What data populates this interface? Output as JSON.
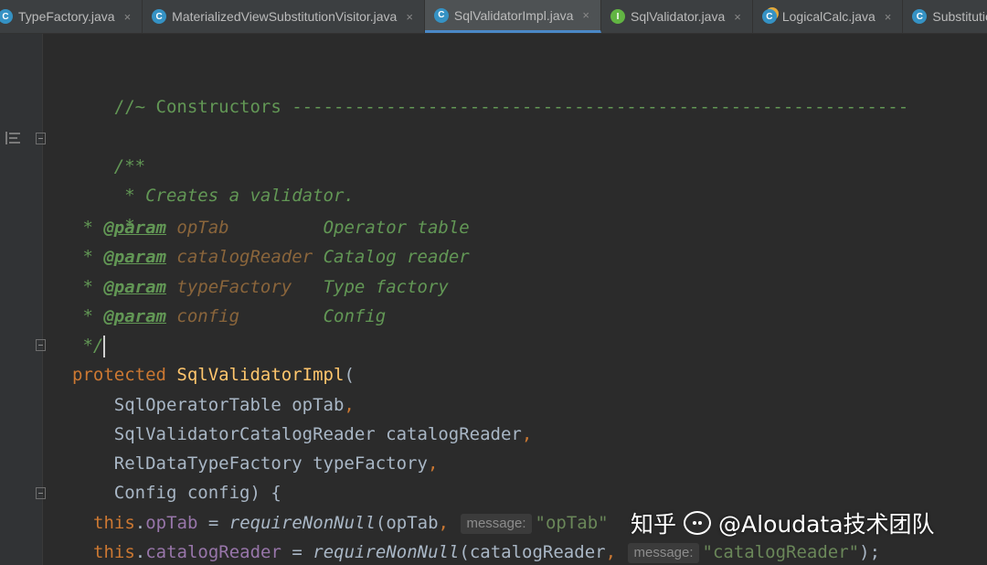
{
  "tabs": [
    {
      "label": "TypeFactory.java",
      "icon": "class-icon",
      "active": false
    },
    {
      "label": "MaterializedViewSubstitutionVisitor.java",
      "icon": "class-icon",
      "active": false
    },
    {
      "label": "SqlValidatorImpl.java",
      "icon": "class-icon",
      "active": true
    },
    {
      "label": "SqlValidator.java",
      "icon": "interface-icon",
      "active": false
    },
    {
      "label": "LogicalCalc.java",
      "icon": "class-icon",
      "active": false
    },
    {
      "label": "SubstitutionVisit",
      "icon": "class-icon",
      "active": false
    }
  ],
  "icon_glyphs": {
    "class": "C",
    "interface": "I",
    "close": "×"
  },
  "code": {
    "section_comment": "//~ Constructors -----------------------------------------------------------",
    "doc_open": "/**",
    "doc_summary": " * Creates a validator.",
    "doc_blank": " *",
    "doc_star": " * ",
    "param_tag": "@param",
    "params": [
      {
        "name": "opTab",
        "pad": "         ",
        "desc": "Operator table"
      },
      {
        "name": "catalogReader",
        "pad": " ",
        "desc": "Catalog reader"
      },
      {
        "name": "typeFactory",
        "pad": "   ",
        "desc": "Type factory"
      },
      {
        "name": "config",
        "pad": "        ",
        "desc": "Config"
      }
    ],
    "doc_close": " */",
    "modifier": "protected",
    "ctor_name": "SqlValidatorImpl",
    "open_paren": "(",
    "args": [
      {
        "text": "    SqlOperatorTable opTab",
        "sep": ","
      },
      {
        "text": "    SqlValidatorCatalogReader catalogReader",
        "sep": ","
      },
      {
        "text": "    RelDataTypeFactory typeFactory",
        "sep": ","
      },
      {
        "text": "    Config config) {",
        "sep": ""
      }
    ],
    "this_kw": "this",
    "assignments": [
      {
        "field": "opTab",
        "eq": " = ",
        "call": "requireNonNull",
        "arg": "(opTab",
        "comma": ",",
        "hint": "message:",
        "str": "\"opTab\"",
        "end": ""
      },
      {
        "field": "catalogReader",
        "eq": " = ",
        "call": "requireNonNull",
        "arg": "(catalogReader",
        "comma": ",",
        "hint": "message:",
        "str": "\"catalogReader\"",
        "end": ");"
      }
    ]
  },
  "watermark": {
    "site": "知乎",
    "handle": "@Aloudata技术团队"
  }
}
